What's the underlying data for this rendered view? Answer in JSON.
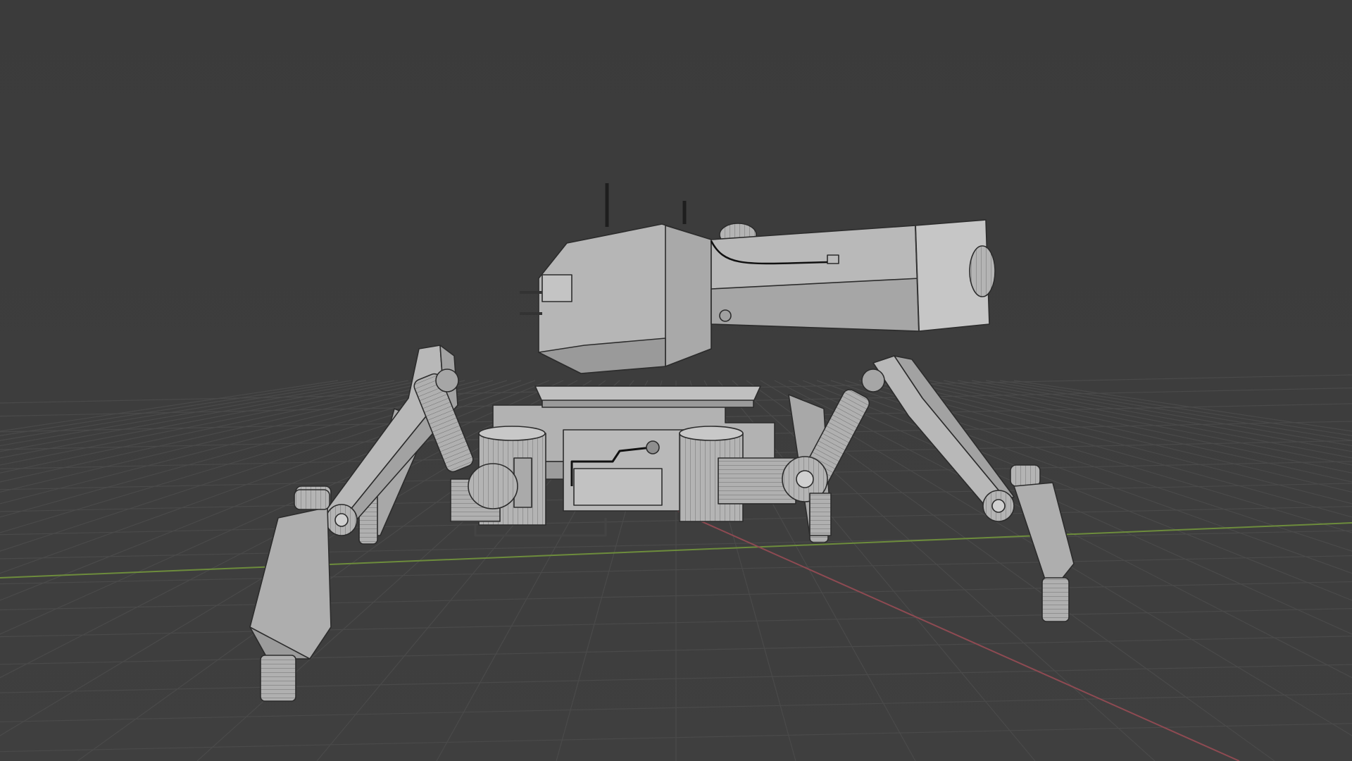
{
  "viewport": {
    "background": "#3d3d3d",
    "grid_color": "#4a4a4a",
    "x_axis_color": "#8a4a50",
    "y_axis_color": "#6a8a3a"
  },
  "model": {
    "base_color": "#b4b4b4",
    "shade_color": "#8e8e8e",
    "light_color": "#d6d6d6",
    "wire_color": "#2a2a2a"
  }
}
